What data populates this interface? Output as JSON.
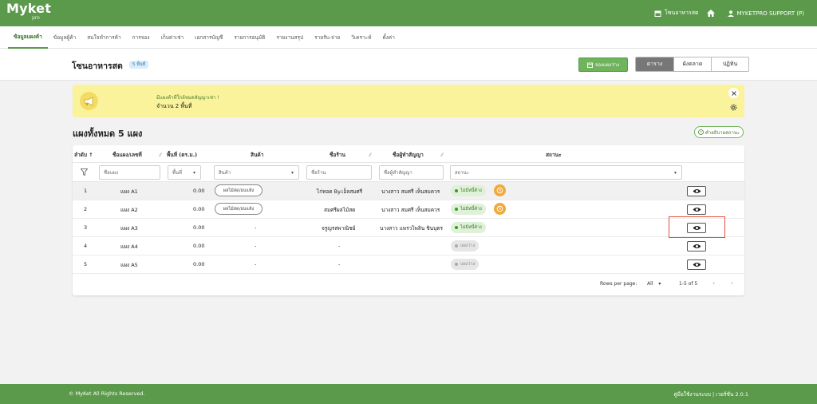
{
  "app": {
    "logo_text": "Myket",
    "logo_sub": "pro"
  },
  "topbar": {
    "store_name": "โซนอาหารสด",
    "user_name": "MYKETPRO SUPPORT (P)"
  },
  "menu": [
    {
      "label": "ข้อมูลแผงค้า",
      "active": true
    },
    {
      "label": "ข้อมูลผู้ค้า"
    },
    {
      "label": "สนใจทำการค้า"
    },
    {
      "label": "การจอง"
    },
    {
      "label": "เก็บค่าเช่า"
    },
    {
      "label": "เอกสารบัญชี"
    },
    {
      "label": "รายการอนุมัติ"
    },
    {
      "label": "รายงานสรุป"
    },
    {
      "label": "รายรับ-จ่าย"
    },
    {
      "label": "วิเคราะห์"
    },
    {
      "label": "ตั้งค่า"
    }
  ],
  "page": {
    "title": "โซนอาหารสด",
    "badge": "5 พื้นที่",
    "book_button": "จองแผงว่าง",
    "views": [
      "ตาราง",
      "ผังตลาด",
      "ปฏิทิน"
    ]
  },
  "notice": {
    "line1": "มีแผงค้าที่ใกล้หมดสัญญาเช่า !",
    "line2": "จำนวน 2 พื้นที่"
  },
  "section": {
    "title": "แผงทั้งหมด 5 แผง",
    "legend_button": "คำอธิบายสถานะ"
  },
  "table": {
    "headers": {
      "no": "ลำดับ ↑",
      "name": "ชื่อแผง/เลขที่",
      "area": "พื้นที่ (ตร.ม.)",
      "product": "สินค้า",
      "shop": "ชื่อร้าน",
      "contract": "ชื่อผู้ทำสัญญา",
      "status": "สถานะ"
    },
    "filters": {
      "name": "ชื่อแผง",
      "area": "พื้นที่",
      "product": "สินค้า",
      "shop": "ชื่อร้าน",
      "contract": "ชื่อผู้ทำสัญญา",
      "status": "สถานะ"
    },
    "rows": [
      {
        "no": "1",
        "name": "แผง A1",
        "area": "0.00",
        "product": "ผลไม้สด/อบแห้ง",
        "shop": "ไก่ทอด By.เอ็ลสมศรี",
        "contract": "นางสาว สมศรี เห็นสมควร",
        "status": "ไม่มีหนี้ค้าง"
      },
      {
        "no": "2",
        "name": "แผง A2",
        "area": "0.00",
        "product": "ผลไม้สด/อบแห้ง",
        "shop": "สมศรีผลไม้สด",
        "contract": "นางสาว สมศรี เห็นสมควร",
        "status": "ไม่มีหนี้ค้าง"
      },
      {
        "no": "3",
        "name": "แผง A3",
        "area": "0.00",
        "product": "-",
        "shop": "จรูญรสพาณิชย์",
        "contract": "นางสาว แพรวไพลิน ชินบุตร",
        "status": "ไม่มีหนี้ค้าง"
      },
      {
        "no": "4",
        "name": "แผง A4",
        "area": "0.00",
        "product": "-",
        "shop": "-",
        "contract": "",
        "status": "แผงว่าง"
      },
      {
        "no": "5",
        "name": "แผง A5",
        "area": "0.00",
        "product": "-",
        "shop": "-",
        "contract": "",
        "status": "แผงว่าง"
      }
    ],
    "pagination": {
      "rows_label": "Rows per page:",
      "rows_value": "All",
      "range": "1-5 of 5"
    }
  },
  "footer": {
    "copyright": "© MyKet All Rights Reserved.",
    "right": "คู่มือใช้งานระบบ | เวอร์ชั่น 2.0.1"
  },
  "colors": {
    "brand": "#5b9a4b",
    "notice_bg": "#fbf39b",
    "highlight": "#e25241",
    "status_ok": "#dff1d8"
  }
}
